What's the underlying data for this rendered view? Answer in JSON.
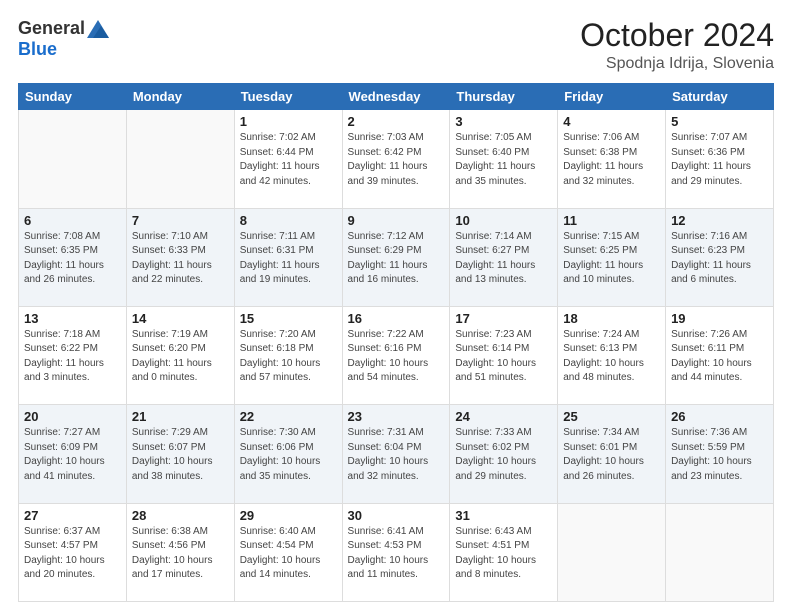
{
  "header": {
    "logo_general": "General",
    "logo_blue": "Blue",
    "month_title": "October 2024",
    "location": "Spodnja Idrija, Slovenia"
  },
  "days_of_week": [
    "Sunday",
    "Monday",
    "Tuesday",
    "Wednesday",
    "Thursday",
    "Friday",
    "Saturday"
  ],
  "weeks": [
    [
      {
        "day": "",
        "content": ""
      },
      {
        "day": "",
        "content": ""
      },
      {
        "day": "1",
        "content": "Sunrise: 7:02 AM\nSunset: 6:44 PM\nDaylight: 11 hours and 42 minutes."
      },
      {
        "day": "2",
        "content": "Sunrise: 7:03 AM\nSunset: 6:42 PM\nDaylight: 11 hours and 39 minutes."
      },
      {
        "day": "3",
        "content": "Sunrise: 7:05 AM\nSunset: 6:40 PM\nDaylight: 11 hours and 35 minutes."
      },
      {
        "day": "4",
        "content": "Sunrise: 7:06 AM\nSunset: 6:38 PM\nDaylight: 11 hours and 32 minutes."
      },
      {
        "day": "5",
        "content": "Sunrise: 7:07 AM\nSunset: 6:36 PM\nDaylight: 11 hours and 29 minutes."
      }
    ],
    [
      {
        "day": "6",
        "content": "Sunrise: 7:08 AM\nSunset: 6:35 PM\nDaylight: 11 hours and 26 minutes."
      },
      {
        "day": "7",
        "content": "Sunrise: 7:10 AM\nSunset: 6:33 PM\nDaylight: 11 hours and 22 minutes."
      },
      {
        "day": "8",
        "content": "Sunrise: 7:11 AM\nSunset: 6:31 PM\nDaylight: 11 hours and 19 minutes."
      },
      {
        "day": "9",
        "content": "Sunrise: 7:12 AM\nSunset: 6:29 PM\nDaylight: 11 hours and 16 minutes."
      },
      {
        "day": "10",
        "content": "Sunrise: 7:14 AM\nSunset: 6:27 PM\nDaylight: 11 hours and 13 minutes."
      },
      {
        "day": "11",
        "content": "Sunrise: 7:15 AM\nSunset: 6:25 PM\nDaylight: 11 hours and 10 minutes."
      },
      {
        "day": "12",
        "content": "Sunrise: 7:16 AM\nSunset: 6:23 PM\nDaylight: 11 hours and 6 minutes."
      }
    ],
    [
      {
        "day": "13",
        "content": "Sunrise: 7:18 AM\nSunset: 6:22 PM\nDaylight: 11 hours and 3 minutes."
      },
      {
        "day": "14",
        "content": "Sunrise: 7:19 AM\nSunset: 6:20 PM\nDaylight: 11 hours and 0 minutes."
      },
      {
        "day": "15",
        "content": "Sunrise: 7:20 AM\nSunset: 6:18 PM\nDaylight: 10 hours and 57 minutes."
      },
      {
        "day": "16",
        "content": "Sunrise: 7:22 AM\nSunset: 6:16 PM\nDaylight: 10 hours and 54 minutes."
      },
      {
        "day": "17",
        "content": "Sunrise: 7:23 AM\nSunset: 6:14 PM\nDaylight: 10 hours and 51 minutes."
      },
      {
        "day": "18",
        "content": "Sunrise: 7:24 AM\nSunset: 6:13 PM\nDaylight: 10 hours and 48 minutes."
      },
      {
        "day": "19",
        "content": "Sunrise: 7:26 AM\nSunset: 6:11 PM\nDaylight: 10 hours and 44 minutes."
      }
    ],
    [
      {
        "day": "20",
        "content": "Sunrise: 7:27 AM\nSunset: 6:09 PM\nDaylight: 10 hours and 41 minutes."
      },
      {
        "day": "21",
        "content": "Sunrise: 7:29 AM\nSunset: 6:07 PM\nDaylight: 10 hours and 38 minutes."
      },
      {
        "day": "22",
        "content": "Sunrise: 7:30 AM\nSunset: 6:06 PM\nDaylight: 10 hours and 35 minutes."
      },
      {
        "day": "23",
        "content": "Sunrise: 7:31 AM\nSunset: 6:04 PM\nDaylight: 10 hours and 32 minutes."
      },
      {
        "day": "24",
        "content": "Sunrise: 7:33 AM\nSunset: 6:02 PM\nDaylight: 10 hours and 29 minutes."
      },
      {
        "day": "25",
        "content": "Sunrise: 7:34 AM\nSunset: 6:01 PM\nDaylight: 10 hours and 26 minutes."
      },
      {
        "day": "26",
        "content": "Sunrise: 7:36 AM\nSunset: 5:59 PM\nDaylight: 10 hours and 23 minutes."
      }
    ],
    [
      {
        "day": "27",
        "content": "Sunrise: 6:37 AM\nSunset: 4:57 PM\nDaylight: 10 hours and 20 minutes."
      },
      {
        "day": "28",
        "content": "Sunrise: 6:38 AM\nSunset: 4:56 PM\nDaylight: 10 hours and 17 minutes."
      },
      {
        "day": "29",
        "content": "Sunrise: 6:40 AM\nSunset: 4:54 PM\nDaylight: 10 hours and 14 minutes."
      },
      {
        "day": "30",
        "content": "Sunrise: 6:41 AM\nSunset: 4:53 PM\nDaylight: 10 hours and 11 minutes."
      },
      {
        "day": "31",
        "content": "Sunrise: 6:43 AM\nSunset: 4:51 PM\nDaylight: 10 hours and 8 minutes."
      },
      {
        "day": "",
        "content": ""
      },
      {
        "day": "",
        "content": ""
      }
    ]
  ]
}
